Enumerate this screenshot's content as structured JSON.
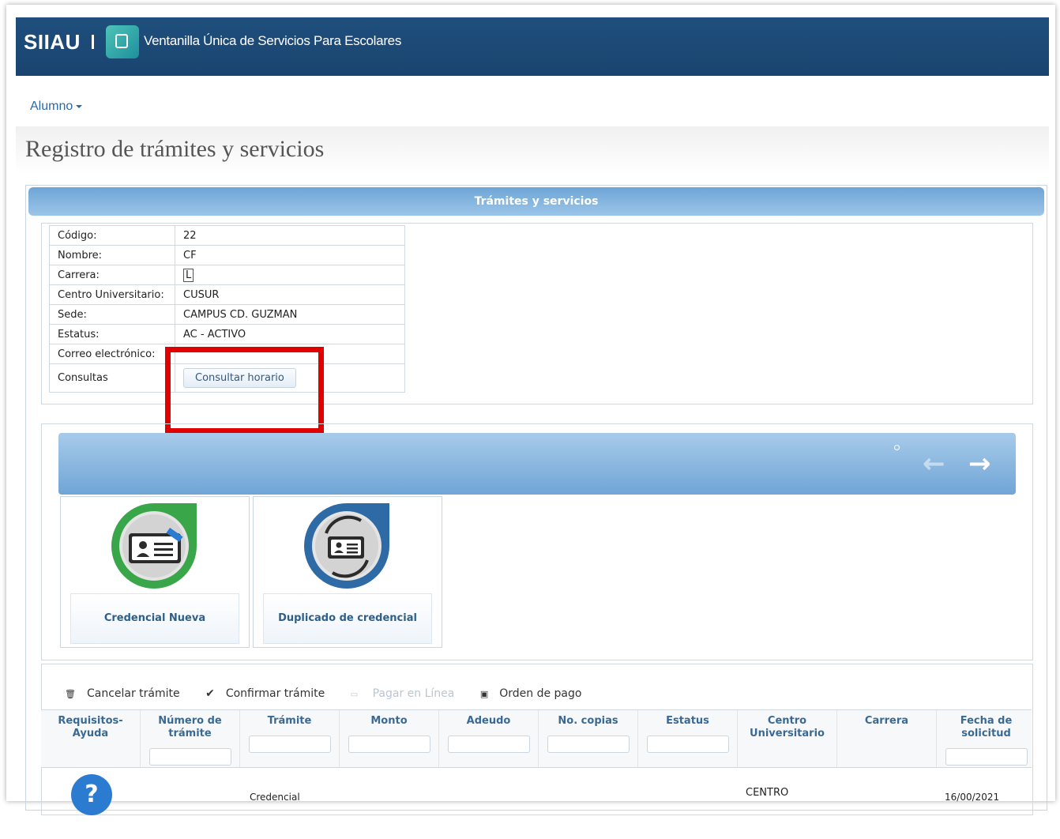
{
  "header": {
    "brand": "SIIAU",
    "subtitle": "Ventanilla Única de Servicios Para Escolares"
  },
  "menu": {
    "alumno": "Alumno"
  },
  "page": {
    "title": "Registro de trámites y servicios",
    "section_title": "Trámites y servicios"
  },
  "student_info": [
    {
      "label": "Código:",
      "value": "22"
    },
    {
      "label": "Nombre:",
      "value": "CF"
    },
    {
      "label": "Carrera:",
      "value": "L"
    },
    {
      "label": "Centro Universitario:",
      "value": "CUSUR"
    },
    {
      "label": "Sede:",
      "value": "CAMPUS CD. GUZMAN"
    },
    {
      "label": "Estatus:",
      "value": "AC - ACTIVO"
    },
    {
      "label": "Correo electrónico:",
      "value": ""
    },
    {
      "label": "Consultas",
      "value": ""
    }
  ],
  "consult_button": "Consultar horario",
  "services": [
    {
      "label": "Credencial Nueva",
      "icon": "new-id-card-icon",
      "ring_color": "#3aa64a"
    },
    {
      "label": "Duplicado de credencial",
      "icon": "duplicate-id-card-icon",
      "ring_color": "#2d6aa6"
    }
  ],
  "actions": {
    "cancel": "Cancelar trámite",
    "confirm": "Confirmar trámite",
    "pay_online": "Pagar en Línea",
    "payment_order": "Orden de pago"
  },
  "table": {
    "columns": [
      "Requisitos-Ayuda",
      "Número de trámite",
      "Trámite",
      "Monto",
      "Adeudo",
      "No. copias",
      "Estatus",
      "Centro Universitario",
      "Carrera",
      "Fecha de solicitud"
    ],
    "first_row": {
      "tramite": "Credencial",
      "centro": "CENTRO",
      "fecha": "16/00/2021"
    }
  },
  "colors": {
    "header_bg": "#1f4f7d",
    "accent": "#6ea5d6",
    "highlight": "#e00000"
  }
}
